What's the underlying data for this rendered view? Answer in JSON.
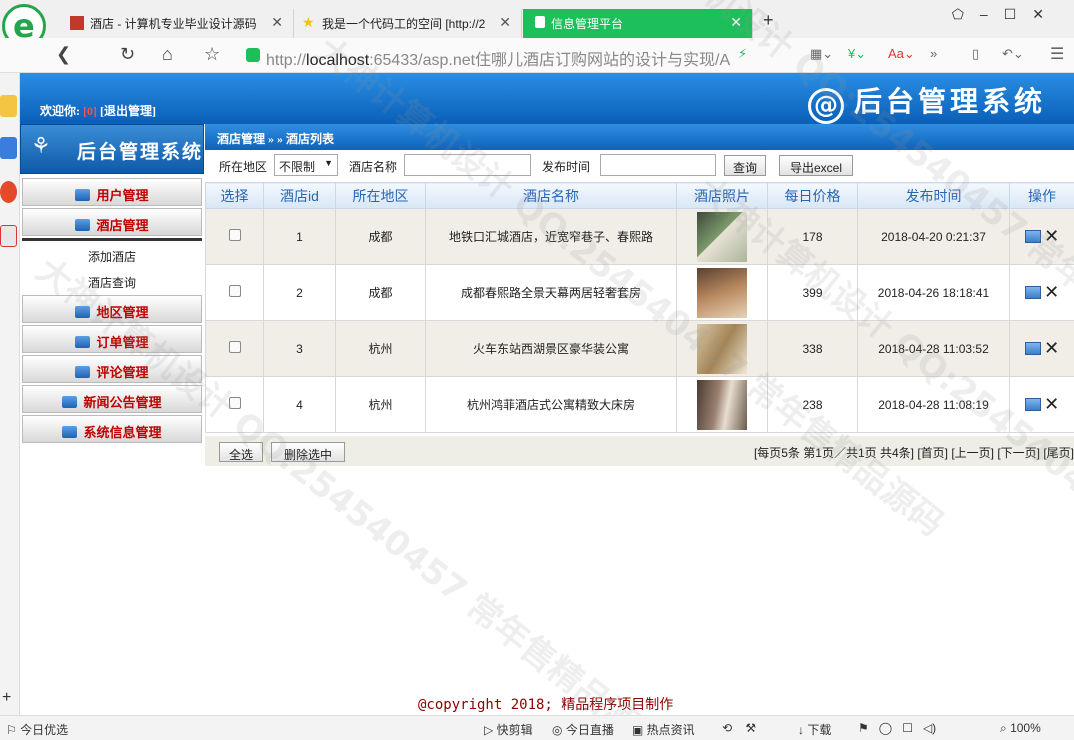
{
  "browser": {
    "tabs": [
      {
        "title": "酒店 - 计算机专业毕业设计源码",
        "icon_color": "#c0392b"
      },
      {
        "title": "我是一个代码工的空间 [http://2",
        "icon_color": "#f1c40f"
      },
      {
        "title": "信息管理平台",
        "icon_color": "#ffffff"
      }
    ],
    "address": {
      "scheme": "http://",
      "host": "localhost",
      "rest": ":65433/asp.net住哪儿酒店订购网站的设计与实现/A"
    },
    "status": {
      "left": "今日优选",
      "items": [
        "快剪辑",
        "今日直播",
        "热点资讯",
        "下载"
      ],
      "zoom": "100%"
    }
  },
  "header": {
    "welcome_prefix": "欢迎你:",
    "user": "[0]",
    "logout": "[退出管理]",
    "brand": "后台管理系统",
    "brand_at": "@"
  },
  "sidebar": {
    "title": "后台管理系统",
    "menus": [
      {
        "label": "用户管理"
      },
      {
        "label": "酒店管理"
      },
      {
        "label": "地区管理"
      },
      {
        "label": "订单管理"
      },
      {
        "label": "评论管理"
      },
      {
        "label": "新闻公告管理"
      },
      {
        "label": "系统信息管理"
      }
    ],
    "submenu": [
      "添加酒店",
      "酒店查询"
    ]
  },
  "breadcrumb": "酒店管理 » » 酒店列表",
  "search": {
    "region_label": "所在地区",
    "region_value": "不限制",
    "name_label": "酒店名称",
    "name_value": "",
    "time_label": "发布时间",
    "time_value": "",
    "query_button": "查询",
    "export_button": "导出excel"
  },
  "table": {
    "headers": [
      "选择",
      "酒店id",
      "所在地区",
      "酒店名称",
      "酒店照片",
      "每日价格",
      "发布时间",
      "操作"
    ],
    "rows": [
      {
        "id": "1",
        "region": "成都",
        "name": "地铁口汇城酒店，近宽窄巷子、春熙路",
        "price": "178",
        "time": "2018-04-20 0:21:37",
        "photo_color": "#5c6f52"
      },
      {
        "id": "2",
        "region": "成都",
        "name": "成都春熙路全景天幕两居轻奢套房",
        "price": "399",
        "time": "2018-04-26 18:18:41",
        "photo_color": "#8a6a4c"
      },
      {
        "id": "3",
        "region": "杭州",
        "name": "火车东站西湖景区豪华装公寓",
        "price": "338",
        "time": "2018-04-28 11:03:52",
        "photo_color": "#b59a70"
      },
      {
        "id": "4",
        "region": "杭州",
        "name": "杭州鸿菲酒店式公寓精致大床房",
        "price": "238",
        "time": "2018-04-28 11:08:19",
        "photo_color": "#7a6a5c"
      }
    ]
  },
  "footer": {
    "select_all": "全选",
    "delete_selected": "删除选中",
    "pager": "[每页5条 第1页／共1页 共4条] [首页] [上一页] [下一页] [尾页]"
  },
  "copyright": "@copyright 2018; 精品程序项目制作",
  "watermark": "大神计算机设计 QQ:254540457 常年售精品源码",
  "colors": {
    "accent": "#0d63bb",
    "menu_text": "#c00000",
    "active_tab": "#1dbf5a"
  }
}
